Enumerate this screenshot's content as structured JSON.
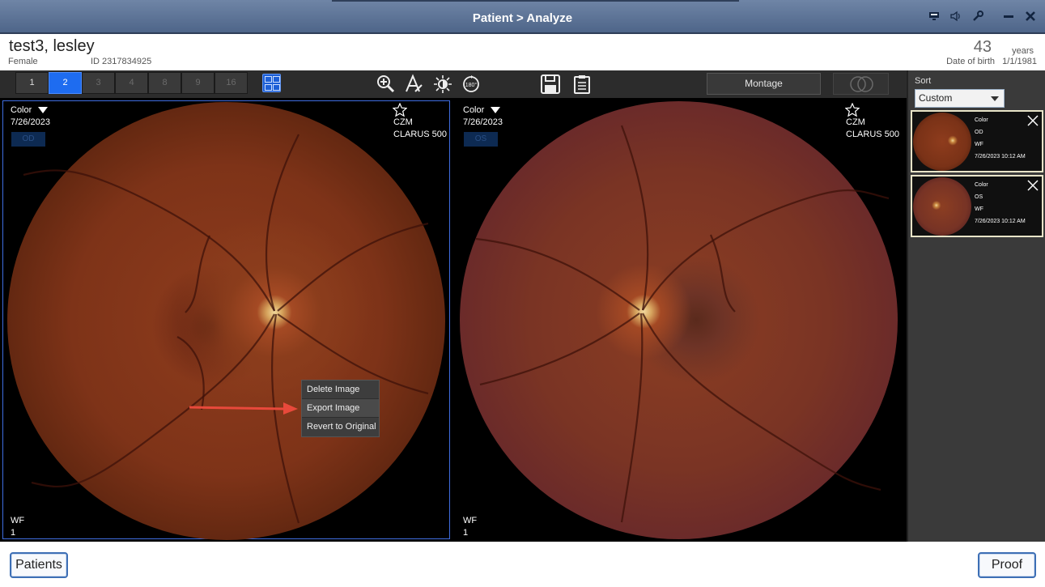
{
  "window": {
    "title": "Patient > Analyze"
  },
  "patient": {
    "name": "test3, lesley",
    "sex": "Female",
    "id": "ID 2317834925",
    "age": "43",
    "age_unit": "years",
    "dob_label": "Date of birth",
    "dob": "1/1/1981"
  },
  "toolbar": {
    "page_buttons": [
      "1",
      "2",
      "3",
      "4",
      "8",
      "9",
      "16"
    ],
    "active_page": "2",
    "montage_label": "Montage",
    "tools": [
      "zoom-in-icon",
      "annotate-icon",
      "brightness-icon",
      "rotate-180-icon",
      "save-icon",
      "clipboard-icon"
    ]
  },
  "panes": {
    "left": {
      "mode": "Color",
      "date": "7/26/2023",
      "eye": "OD",
      "vendor": "CZM",
      "device": "CLARUS 500",
      "field": "WF",
      "index": "1"
    },
    "right": {
      "mode": "Color",
      "date": "7/26/2023",
      "eye": "OS",
      "vendor": "CZM",
      "device": "CLARUS 500",
      "field": "WF",
      "index": "1"
    }
  },
  "context_menu": {
    "items": [
      "Delete Image",
      "Export Image",
      "Revert to Original"
    ],
    "highlighted": "Export Image"
  },
  "sidebar": {
    "sort_label": "Sort",
    "sort_value": "Custom",
    "thumbnails": [
      {
        "mode": "Color",
        "eye": "OD",
        "field": "WF",
        "datetime": "7/26/2023 10:12 AM"
      },
      {
        "mode": "Color",
        "eye": "OS",
        "field": "WF",
        "datetime": "7/26/2023 10:12 AM"
      }
    ]
  },
  "bottom": {
    "patients_label": "Patients",
    "proof_label": "Proof"
  },
  "colors": {
    "titlebar": "#5a7196",
    "accent": "#1e6cf0",
    "selection_border": "#3f6de0",
    "annotation_arrow": "#e8493b"
  }
}
